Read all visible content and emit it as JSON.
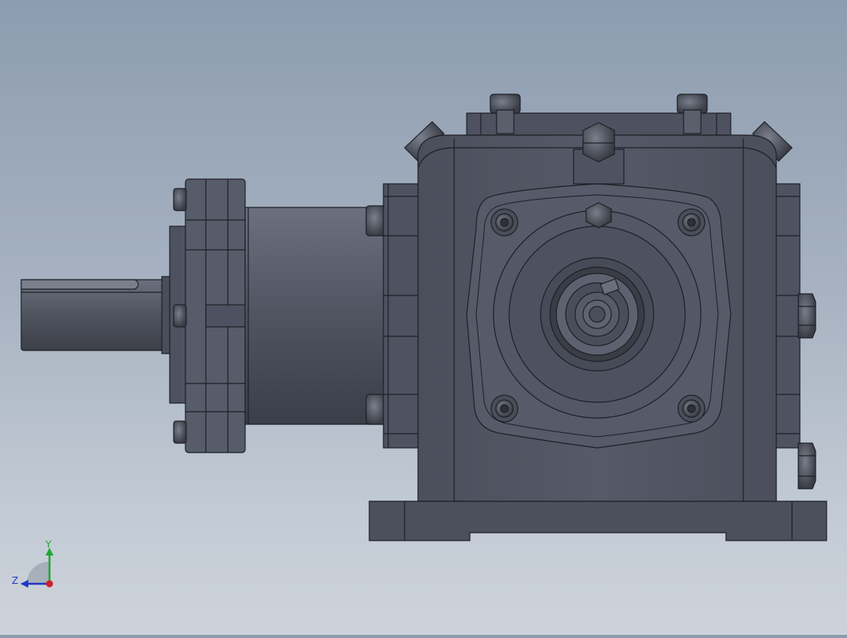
{
  "viewport": {
    "background_top": "#8d9cb0",
    "background_bottom": "#cdd3da",
    "model_color": "#555a68",
    "edge_color": "#1e2026"
  },
  "triad": {
    "x_label": "",
    "y_label": "Y",
    "z_label": "Z",
    "x_color": "#d0202a",
    "y_color": "#1fa832",
    "z_color": "#2037c8"
  }
}
